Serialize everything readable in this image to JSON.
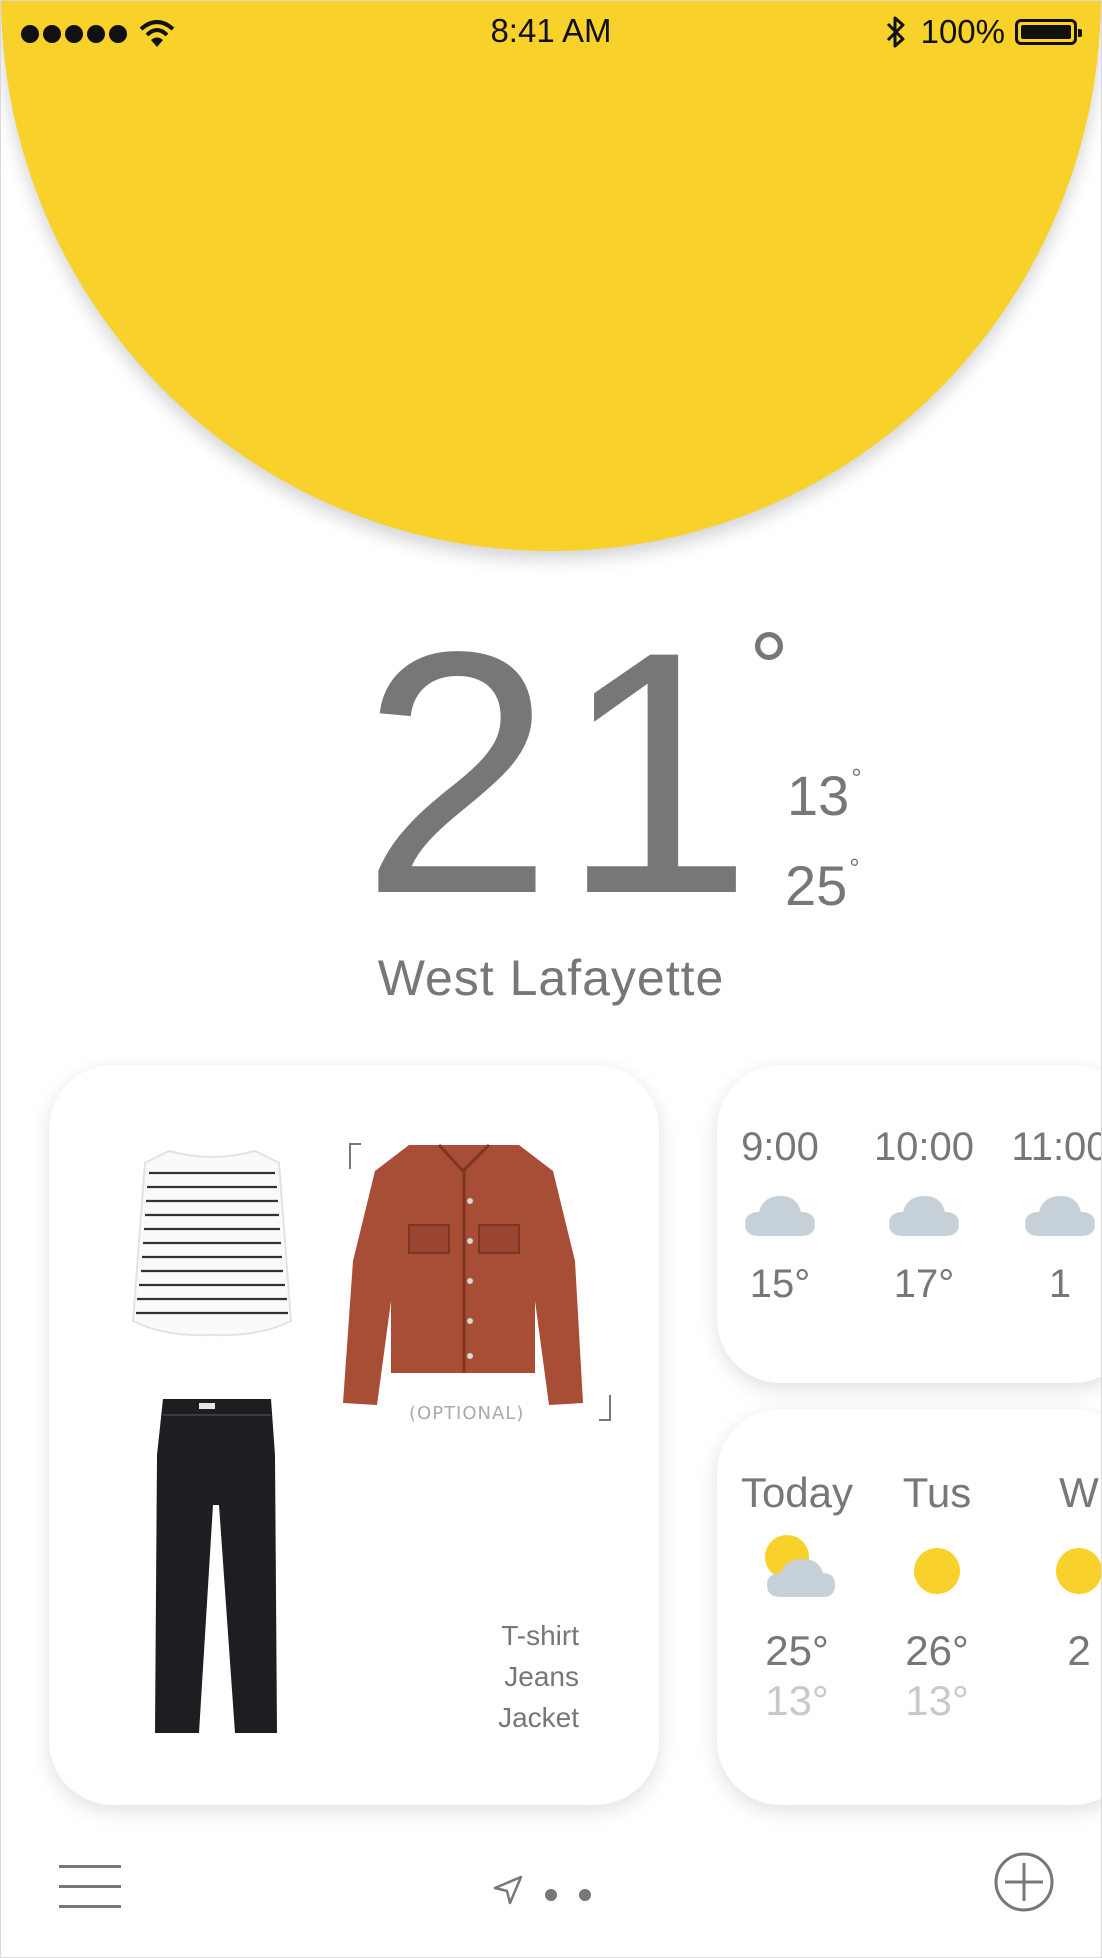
{
  "status_bar": {
    "time": "8:41 AM",
    "battery": "100%",
    "icons": [
      "signal-dots-icon",
      "wifi-icon",
      "bluetooth-icon",
      "battery-icon"
    ]
  },
  "current": {
    "temperature": "21",
    "degree": "°",
    "low": "13",
    "high": "25",
    "small_degree": "°",
    "city": "West Lafayette"
  },
  "outfit": {
    "items": [
      "T-shirt",
      "Jeans",
      "Jacket"
    ],
    "optional_label": "(OPTIONAL)",
    "images": [
      "striped-tshirt",
      "black-jeans",
      "rust-denim-jacket"
    ]
  },
  "hourly": [
    {
      "time": "9:00",
      "temp": "15°",
      "icon": "cloud-icon"
    },
    {
      "time": "10:00",
      "temp": "17°",
      "icon": "cloud-icon"
    },
    {
      "time": "11:00",
      "temp": "1",
      "icon": "cloud-icon"
    }
  ],
  "daily": [
    {
      "day": "Today",
      "high": "25°",
      "low": "13°",
      "icon": "partly-cloudy-icon"
    },
    {
      "day": "Tus",
      "high": "26°",
      "low": "13°",
      "icon": "sun-icon"
    },
    {
      "day": "W",
      "high": "2",
      "low": "",
      "icon": "sun-icon"
    }
  ],
  "colors": {
    "accent_yellow": "#f8d12a",
    "text_gray": "#777777",
    "cloud_gray": "#c5d0d8",
    "low_temp_gray": "#c9c9c9"
  },
  "bottom_bar": {
    "icons": [
      "menu-icon",
      "location-arrow-icon",
      "page-dot",
      "page-dot",
      "add-icon"
    ]
  }
}
